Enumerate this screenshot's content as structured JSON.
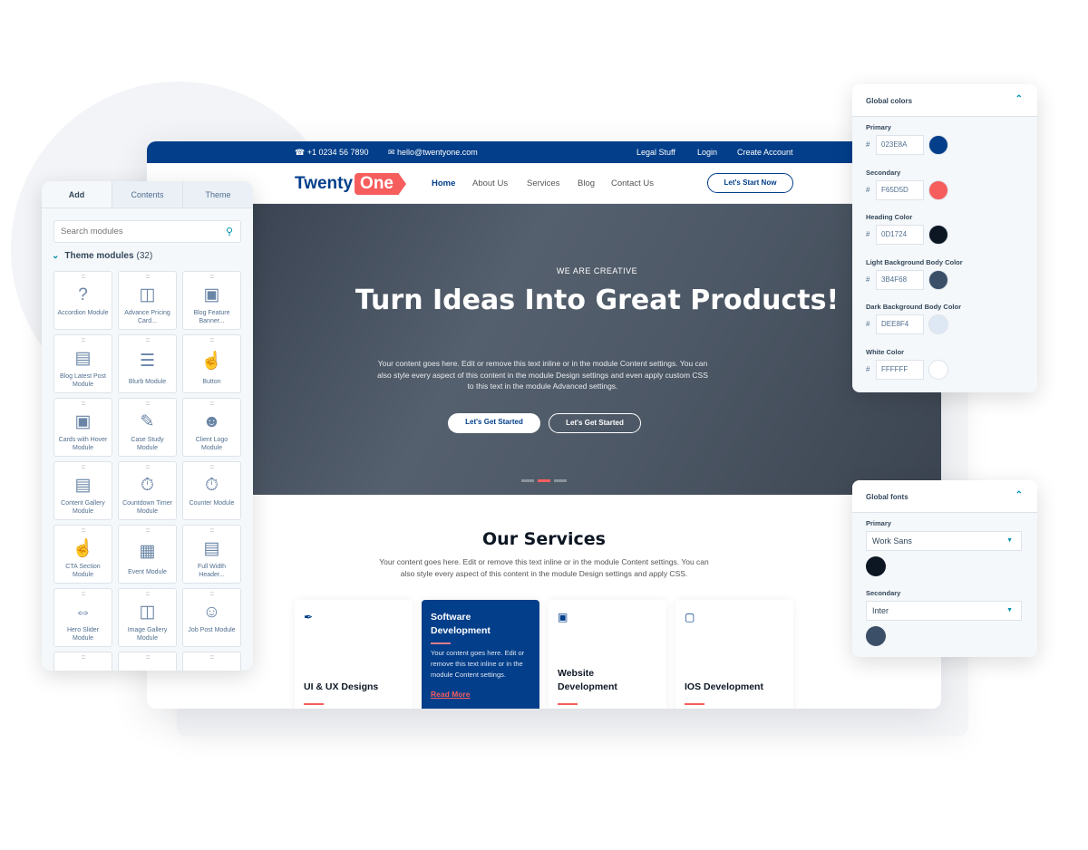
{
  "topbar": {
    "phone": "+1 0234 56 7890",
    "email": "hello@twentyone.com",
    "links": [
      "Legal Stuff",
      "Login",
      "Create Account"
    ]
  },
  "nav": {
    "logo_a": "Twenty",
    "logo_b": "One",
    "items": [
      "Home",
      "About Us",
      "Services",
      "Blog",
      "Contact Us"
    ],
    "active": "Home",
    "cta": "Let's Start Now"
  },
  "hero": {
    "kicker": "WE ARE CREATIVE",
    "title": "Turn Ideas Into Great Products!",
    "body": "Your content goes here. Edit or remove this text inline or in the module Content settings. You can also style every aspect of this content in the module Design settings and even apply custom CSS to this text in the module Advanced settings.",
    "btn1": "Let's Get Started",
    "btn2": "Let's Get Started",
    "slide_count": 3,
    "active_slide": 2
  },
  "services": {
    "title": "Our Services",
    "intro": "Your content goes here. Edit or remove this text inline or in the module Content settings. You can also style every aspect of this content in the module Design settings and apply CSS.",
    "cards": [
      {
        "icon": "pen-icon",
        "title": "UI & UX Designs"
      },
      {
        "icon": "",
        "title": "Software Development",
        "desc": "Your content goes here. Edit or remove this text inline or in the module Content settings.",
        "link": "Read More"
      },
      {
        "icon": "briefcase-icon",
        "title": "Website Development"
      },
      {
        "icon": "monitor-icon",
        "title": "IOS Development"
      }
    ]
  },
  "panel": {
    "tabs": [
      "Add",
      "Contents",
      "Theme"
    ],
    "active_tab": "Add",
    "search_placeholder": "Search modules",
    "section": "Theme modules",
    "count": "(32)",
    "modules": [
      {
        "label": "Accordion Module",
        "icon": "question-icon"
      },
      {
        "label": "Advance Pricing Card...",
        "icon": "id-badge-icon"
      },
      {
        "label": "Blog Feature Banner...",
        "icon": "image-icon"
      },
      {
        "label": "Blog Latest Post Module",
        "icon": "laptop-image-icon"
      },
      {
        "label": "Blurb Module",
        "icon": "layout-icon"
      },
      {
        "label": "Button",
        "icon": "pointer-hand-icon"
      },
      {
        "label": "Cards with Hover Module",
        "icon": "card-hover-icon"
      },
      {
        "label": "Case Study Module",
        "icon": "clipboard-edit-icon"
      },
      {
        "label": "Client Logo Module",
        "icon": "users-icon"
      },
      {
        "label": "Content Gallery Module",
        "icon": "monitor-image-icon"
      },
      {
        "label": "Countdown Timer Module",
        "icon": "timer-20-icon"
      },
      {
        "label": "Counter Module",
        "icon": "stopwatch-icon"
      },
      {
        "label": "CTA Section Module",
        "icon": "pointer-hand-icon"
      },
      {
        "label": "Event Module",
        "icon": "calendar-icon"
      },
      {
        "label": "Full Width Header...",
        "icon": "header-icon"
      },
      {
        "label": "Hero Slider Module",
        "icon": "slider-icon"
      },
      {
        "label": "Image Gallery Module",
        "icon": "gallery-icon"
      },
      {
        "label": "Job Post Module",
        "icon": "user-search-icon"
      },
      {
        "label": "",
        "icon": ""
      },
      {
        "label": "",
        "icon": ""
      },
      {
        "label": "",
        "icon": ""
      }
    ]
  },
  "global_colors": {
    "title": "Global colors",
    "items": [
      {
        "label": "Primary",
        "hex": "023E8A",
        "color": "#023E8A"
      },
      {
        "label": "Secondary",
        "hex": "F65D5D",
        "color": "#F65D5D"
      },
      {
        "label": "Heading Color",
        "hex": "0D1724",
        "color": "#0D1724"
      },
      {
        "label": "Light Background Body Color",
        "hex": "3B4F68",
        "color": "#3B4F68"
      },
      {
        "label": "Dark Background Body Color",
        "hex": "DEE8F4",
        "color": "#DEE8F4"
      },
      {
        "label": "White Color",
        "hex": "FFFFFF",
        "color": "#FFFFFF"
      }
    ]
  },
  "global_fonts": {
    "title": "Global fonts",
    "items": [
      {
        "label": "Primary",
        "value": "Work Sans",
        "color": "#0D1724"
      },
      {
        "label": "Secondary",
        "value": "Inter",
        "color": "#3B4F68"
      }
    ]
  }
}
